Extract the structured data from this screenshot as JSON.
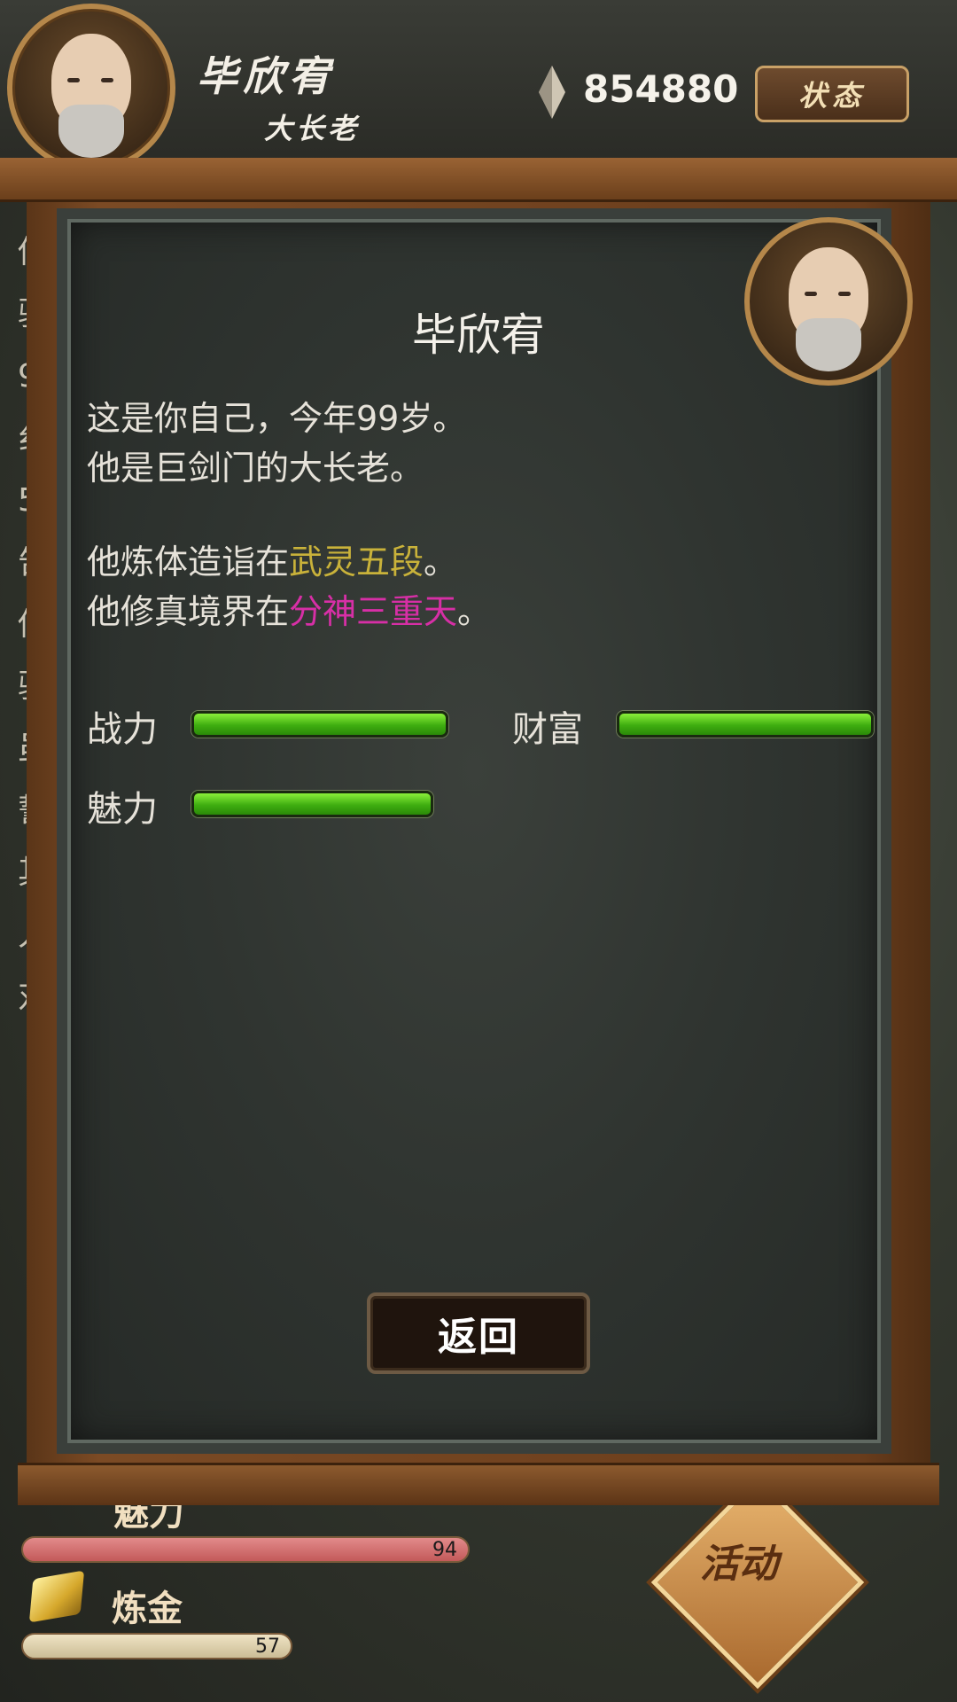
{
  "header": {
    "name": "毕欣宥",
    "title": "大长老",
    "currency": "854880",
    "status_button": "状态"
  },
  "background": {
    "left_text_chars": [
      "你",
      "驴",
      "",
      "9",
      "纟",
      "5",
      "告",
      "你",
      "驴",
      "虽",
      "誓",
      "其",
      "人",
      "对"
    ],
    "stat_label_partial": "魅力",
    "charm_value": "94",
    "gold_label": "炼金",
    "gold_value": "57",
    "activity_button": "活动"
  },
  "dialog": {
    "name": "毕欣宥",
    "line1": "这是你自己，今年99岁。",
    "line2": "他是巨剑门的大长老。",
    "body_prefix": "他炼体造诣在",
    "body_realm": "武灵五段",
    "body_suffix": "。",
    "cult_prefix": "他修真境界在",
    "cult_realm": "分神三重天",
    "cult_suffix": "。",
    "stats": [
      {
        "label": "战力",
        "level": 1.0
      },
      {
        "label": "财富",
        "level": 1.0
      },
      {
        "label": "魅力",
        "level": 0.94
      }
    ],
    "back_button": "返回"
  },
  "colors": {
    "realm_body": "#c9b23a",
    "realm_cultivation": "#d72fa6",
    "bar_green": "#3fae10"
  }
}
